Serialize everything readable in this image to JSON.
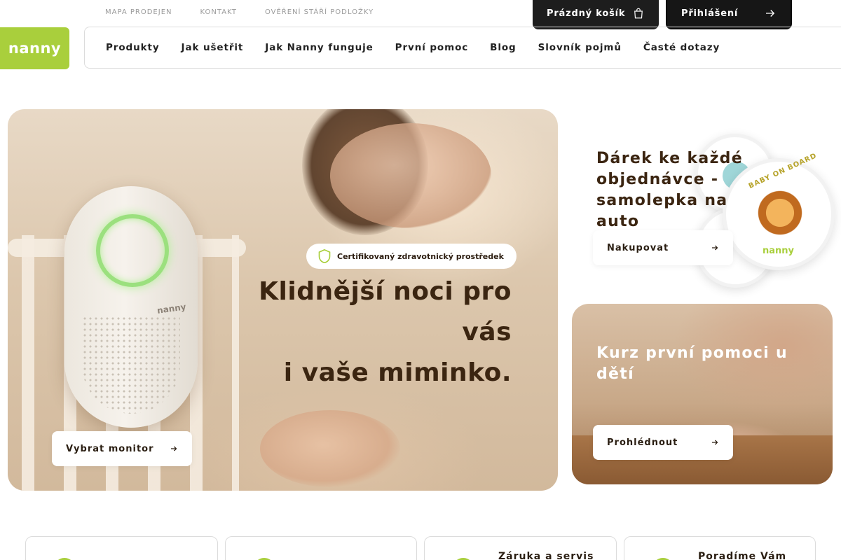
{
  "utility_links": [
    "MAPA PRODEJEN",
    "KONTAKT",
    "OVĚŘENÍ STÁŘÍ PODLOŽKY"
  ],
  "cart": {
    "label": "Prázdný košík",
    "icon": "shopping-bag-icon"
  },
  "login": {
    "label": "Přihlášení",
    "icon": "arrow-right-icon"
  },
  "logo": {
    "text": "nanny",
    "color": "#a9cf3c"
  },
  "nav": [
    "Produkty",
    "Jak ušetřit",
    "Jak Nanny funguje",
    "První pomoc",
    "Blog",
    "Slovník pojmů",
    "Časté dotazy"
  ],
  "hero": {
    "badge": "Certifikovaný zdravotnický prostředek",
    "badge_icon": "shield-icon",
    "headline_line1": "Klidnější noci pro vás",
    "headline_line2": "i vaše miminko.",
    "device_label": "nanny",
    "button": "Vybrat monitor"
  },
  "promo_gift": {
    "title": "Dárek ke každé objednávce - samolepka na auto",
    "sticker_text": "BABY ON BOARD",
    "sticker_brand": "nanny",
    "button": "Nakupovat"
  },
  "promo_course": {
    "title": "Kurz první pomoci u dětí",
    "button": "Prohlédnout"
  },
  "features": [
    {
      "title": ""
    },
    {
      "title": ""
    },
    {
      "title": "Záruka a servis"
    },
    {
      "title": "Poradíme Vám"
    }
  ],
  "colors": {
    "accent": "#a9cf3c",
    "dark": "#1d1d1d",
    "text": "#3b2511"
  }
}
